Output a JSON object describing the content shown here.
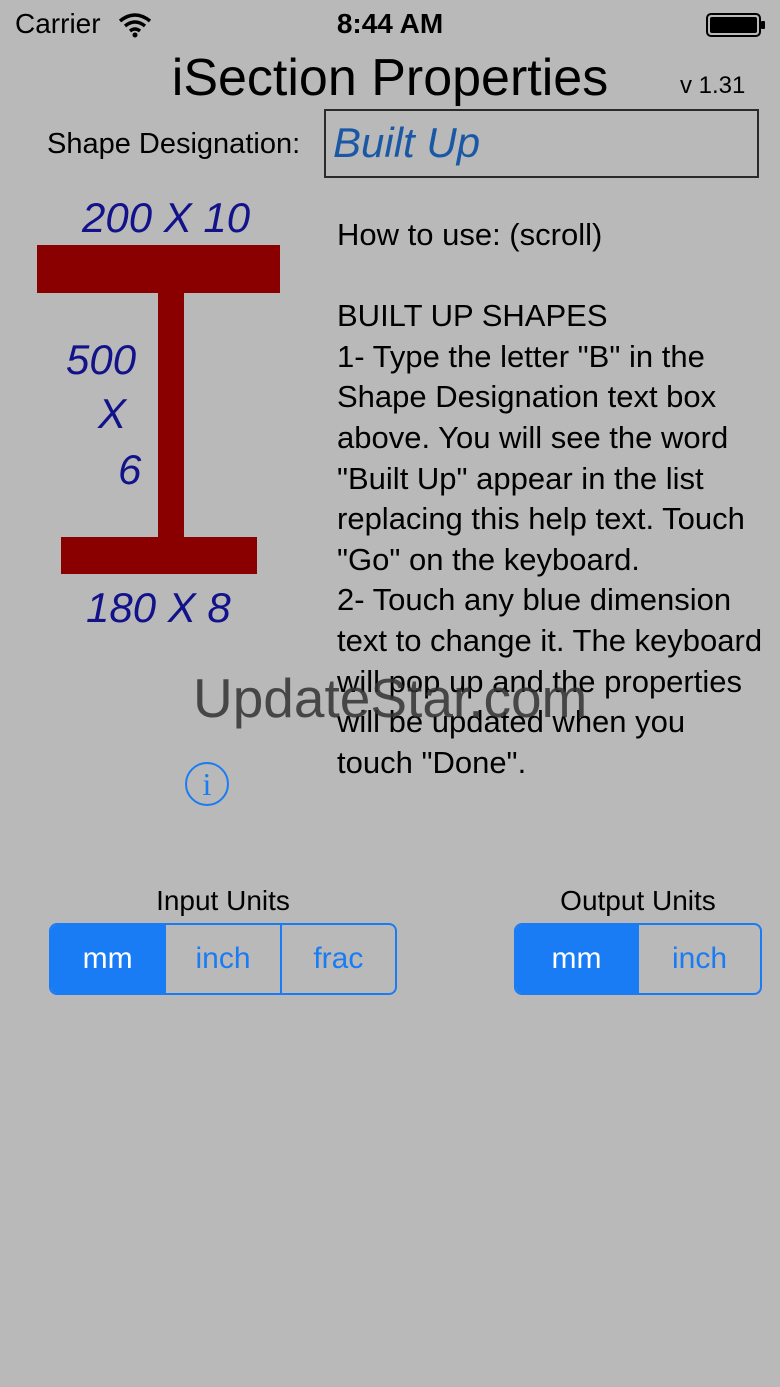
{
  "status_bar": {
    "carrier": "Carrier",
    "time": "8:44 AM"
  },
  "header": {
    "title": "iSection Properties",
    "version": "v 1.31"
  },
  "shape": {
    "label": "Shape Designation:",
    "value": "Built Up"
  },
  "section": {
    "top_flange": "200 X 10",
    "web_depth": "500",
    "web_x": "X",
    "web_thickness": "6",
    "bottom_flange": "180 X 8",
    "flange_color": "#8a0000",
    "dimension_color": "#12128a"
  },
  "help": {
    "text": "How to use: (scroll)\n\nBUILT UP SHAPES\n1- Type the letter \"B\" in the Shape Designation text box above. You will see the word \"Built Up\" appear in the list replacing this help text.  Touch \"Go\" on the keyboard.\n2- Touch any blue dimension text to change it. The keyboard will pop up and the properties will be updated when you touch \"Done\"."
  },
  "watermark": "UpdateStar.com",
  "info_icon": "info-icon",
  "input_units": {
    "title": "Input Units",
    "options": [
      "mm",
      "inch",
      "frac"
    ],
    "selected": "mm"
  },
  "output_units": {
    "title": "Output Units",
    "options": [
      "mm",
      "inch"
    ],
    "selected": "mm"
  },
  "colors": {
    "background": "#b9b9b9",
    "accent": "#1a7cf5",
    "shape_value": "#1a58a6"
  }
}
